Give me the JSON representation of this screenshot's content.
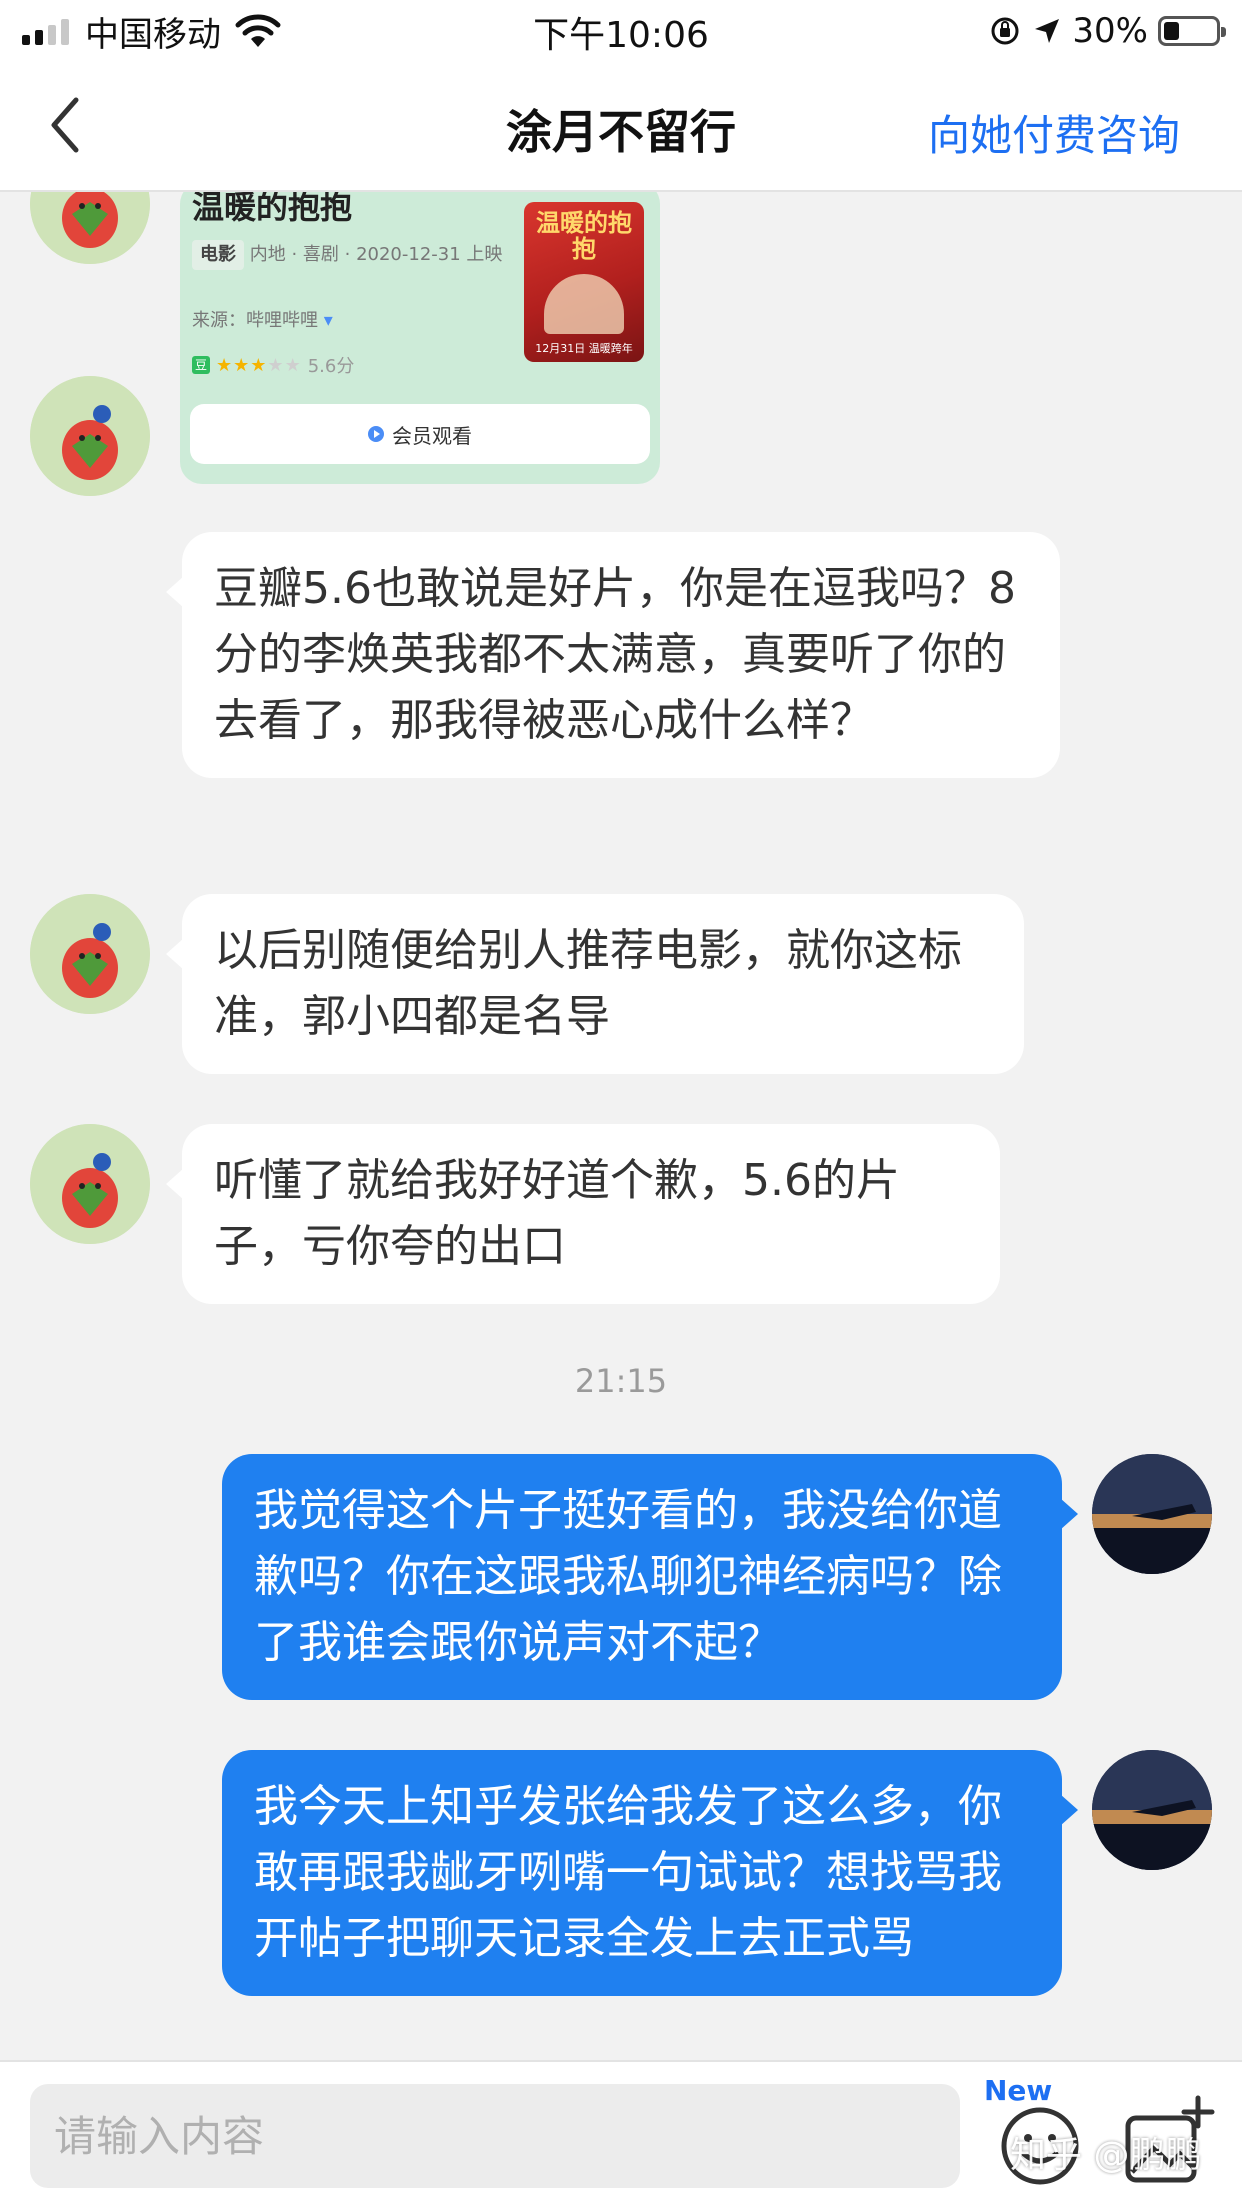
{
  "status_bar": {
    "carrier": "中国移动",
    "time": "下午10:06",
    "battery": "30%",
    "battery_level": 0.3
  },
  "nav": {
    "title": "涂月不留行",
    "action": "向她付费咨询"
  },
  "movie_card": {
    "title": "温暖的抱抱",
    "tag": "电影",
    "meta": "内地 · 喜剧 · 2020-12-31 上映",
    "source": "来源：哔哩哔哩",
    "douban_badge": "豆",
    "rating": "5.6分",
    "stars_filled": 3,
    "stars_total": 5,
    "poster_title": "温暖的抱抱",
    "poster_date": "12月31日 温暖跨年",
    "watch_label": "会员观看"
  },
  "messages": [
    {
      "side": "left",
      "text": "豆瓣5.6也敢说是好片，你是在逗我吗？8分的李焕英我都不太满意，真要听了你的去看了，那我得被恶心成什么样？"
    },
    {
      "side": "left",
      "text": "以后别随便给别人推荐电影，就你这标准，郭小四都是名导"
    },
    {
      "side": "left",
      "text": "听懂了就给我好好道个歉，5.6的片子，亏你夸的出口"
    },
    {
      "side": "right",
      "text": "我觉得这个片子挺好看的，我没给你道歉吗？你在这跟我私聊犯神经病吗？除了我谁会跟你说声对不起？"
    },
    {
      "side": "right",
      "text": "我今天上知乎发张给我发了这么多，你敢再跟我龇牙咧嘴一句试试？想找骂我开帖子把聊天记录全发上去正式骂"
    }
  ],
  "timestamp": "21:15",
  "input": {
    "placeholder": "请输入内容",
    "value": "",
    "new_badge": "New"
  },
  "watermark": "知乎 @鹏鹏",
  "colors": {
    "accent": "#1d6ff2",
    "bubble_right": "#1f80f0",
    "bubble_left": "#ffffff",
    "card_bg": "#cdebd8"
  },
  "icons": [
    "back-chevron-icon",
    "wifi-icon",
    "battery-icon",
    "emoji-icon",
    "image-add-icon"
  ]
}
